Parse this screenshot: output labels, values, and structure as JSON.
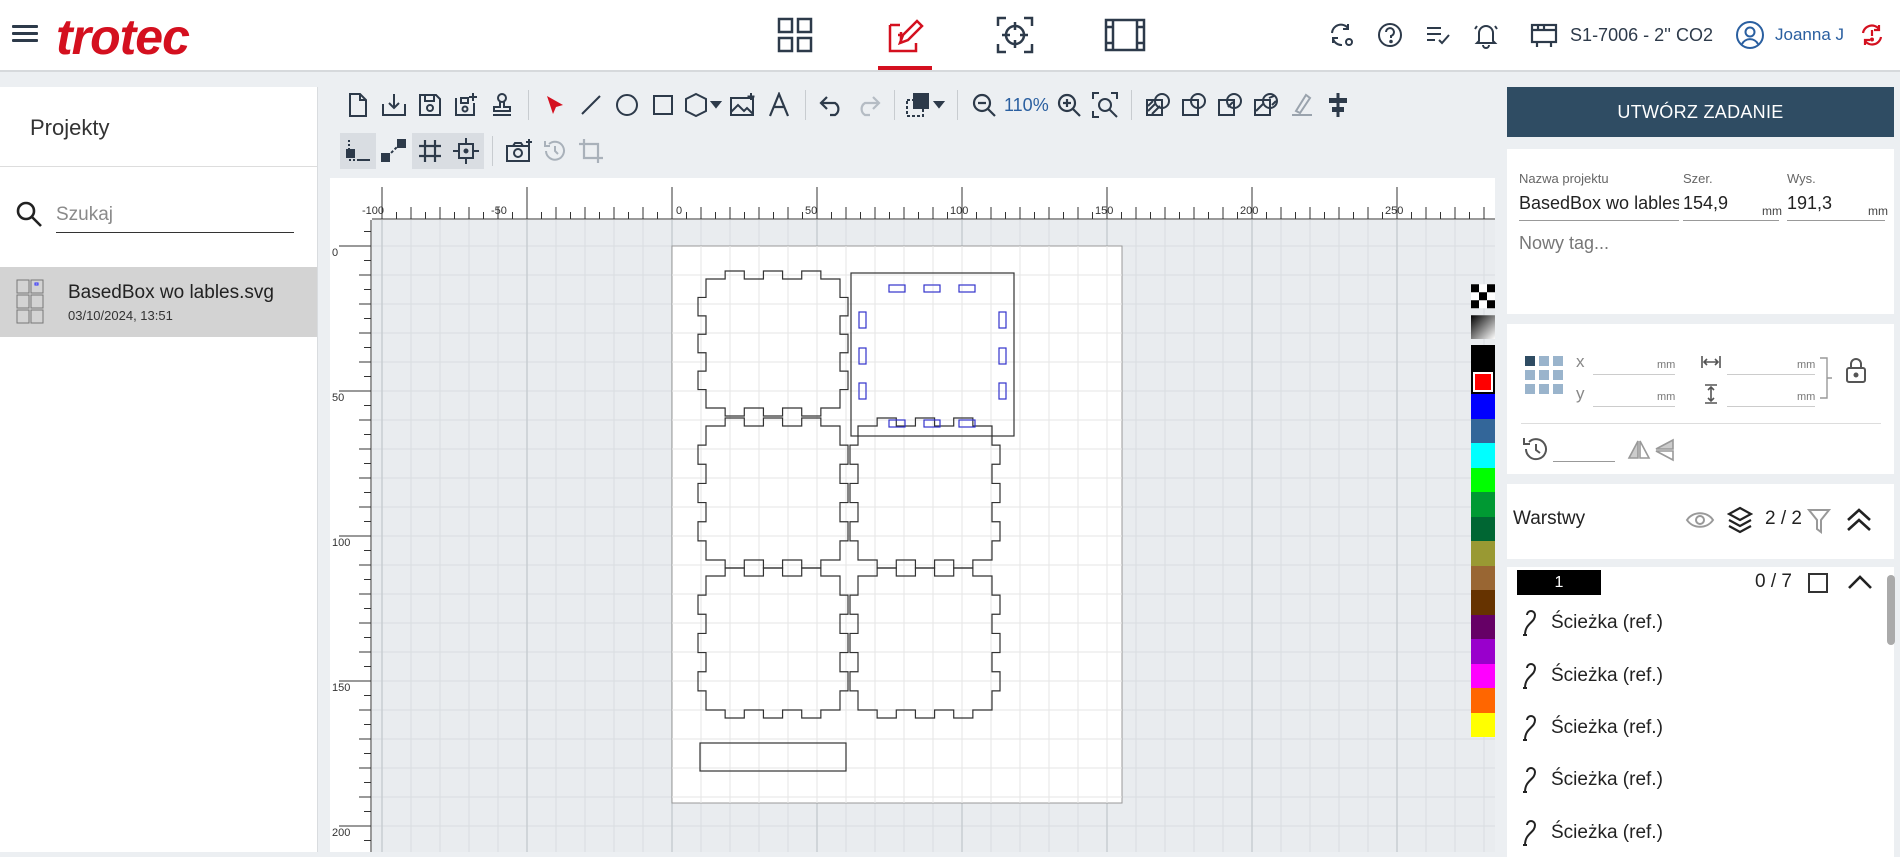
{
  "brand": {
    "logo_text": "trotec",
    "accent": "#d4101f"
  },
  "nav": {
    "tabs": [
      {
        "name": "dashboard",
        "icon": "grid-icon"
      },
      {
        "name": "design",
        "icon": "design-pen-icon",
        "active": true
      },
      {
        "name": "position",
        "icon": "crosshair-icon"
      },
      {
        "name": "job-queue",
        "icon": "film-icon"
      }
    ]
  },
  "header_right": {
    "machine_label": "S1-7006 - 2'' CO2",
    "user_name": "Joanna J"
  },
  "projects": {
    "title": "Projekty",
    "search_placeholder": "Szukaj",
    "files": [
      {
        "name": "BasedBox wo lables.svg",
        "date": "03/10/2024, 13:51"
      }
    ]
  },
  "toolbar": {
    "zoom": "110%"
  },
  "ruler": {
    "h_labels": [
      "-100",
      "-50",
      "0",
      "50",
      "100",
      "150",
      "200",
      "250"
    ],
    "v_labels": [
      "0",
      "50",
      "100",
      "150",
      "200"
    ]
  },
  "palette": {
    "colors": [
      "#000000",
      "#ff0000",
      "#0000ff",
      "#336699",
      "#00ffff",
      "#00ff00",
      "#009933",
      "#006633",
      "#999933",
      "#996633",
      "#663300",
      "#660066",
      "#9900cc",
      "#ff00ff",
      "#ff6600",
      "#ffff00"
    ]
  },
  "job": {
    "create_label": "UTWÓRZ ZADANIE",
    "project_name_label": "Nazwa projektu",
    "project_name": "BasedBox wo lables",
    "width_label": "Szer.",
    "width": "154,9",
    "height_label": "Wys.",
    "height": "191,3",
    "unit": "mm",
    "tag_placeholder": "Nowy tag..."
  },
  "transform": {
    "x_label": "x",
    "y_label": "y",
    "unit": "mm"
  },
  "layers": {
    "title": "Warstwy",
    "count": "2 / 2",
    "layer1": {
      "badge": "1",
      "count": "0 / 7"
    },
    "items": [
      "Ścieżka (ref.)",
      "Ścieżka (ref.)",
      "Ścieżka (ref.)",
      "Ścieżka (ref.)",
      "Ścieżka (ref.)"
    ]
  }
}
